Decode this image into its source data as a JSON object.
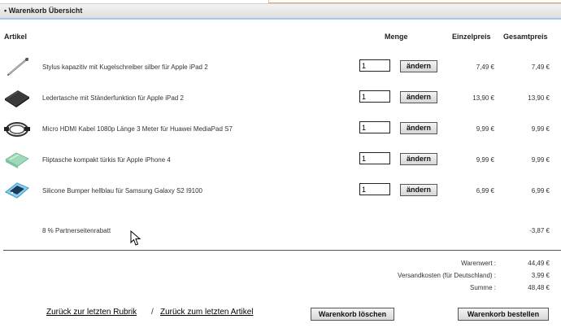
{
  "header": {
    "title": "• Warenkorb Übersicht"
  },
  "columns": {
    "article": "Artikel",
    "quantity": "Menge",
    "unit_price": "Einzelpreis",
    "total_price": "Gesamtpreis"
  },
  "items": [
    {
      "name": "Stylus kapazitiv mit Kugelschreiber silber für Apple iPad 2",
      "quantity": "1",
      "unit_price": "7,49 €",
      "total_price": "7,49 €",
      "icon": "stylus-pen-icon"
    },
    {
      "name": "Ledertasche mit Ständerfunktion für Apple iPad 2",
      "quantity": "1",
      "unit_price": "13,90 €",
      "total_price": "13,90 €",
      "icon": "leather-case-icon"
    },
    {
      "name": "Micro HDMI Kabel 1080p Länge 3 Meter für Huawei MediaPad S7",
      "quantity": "1",
      "unit_price": "9,99 €",
      "total_price": "9,99 €",
      "icon": "hdmi-cable-icon"
    },
    {
      "name": "Fliptasche kompakt türkis für Apple iPhone 4",
      "quantity": "1",
      "unit_price": "9,99 €",
      "total_price": "9,99 €",
      "icon": "flip-case-icon"
    },
    {
      "name": "Silicone Bumper hellblau für Samsung Galaxy S2 I9100",
      "quantity": "1",
      "unit_price": "6,99 €",
      "total_price": "6,99 €",
      "icon": "bumper-case-icon"
    }
  ],
  "change_label": "ändern",
  "discount": {
    "label": "8 % Partnerseitenrabatt",
    "value": "-3,87 €"
  },
  "summary": {
    "goods_label": "Warenwert :",
    "goods_value": "44,49 €",
    "shipping_label": "Versandkosten (für Deutschland) :",
    "shipping_value": "3,99 €",
    "sum_label": "Summe :",
    "sum_value": "48,48 €"
  },
  "footer": {
    "back_category": "Zurück zur letzten Rubrik",
    "separator": "/",
    "back_article": "Zurück zum letzten Artikel",
    "clear_cart": "Warenkorb löschen",
    "order_cart": "Warenkorb bestellen"
  }
}
